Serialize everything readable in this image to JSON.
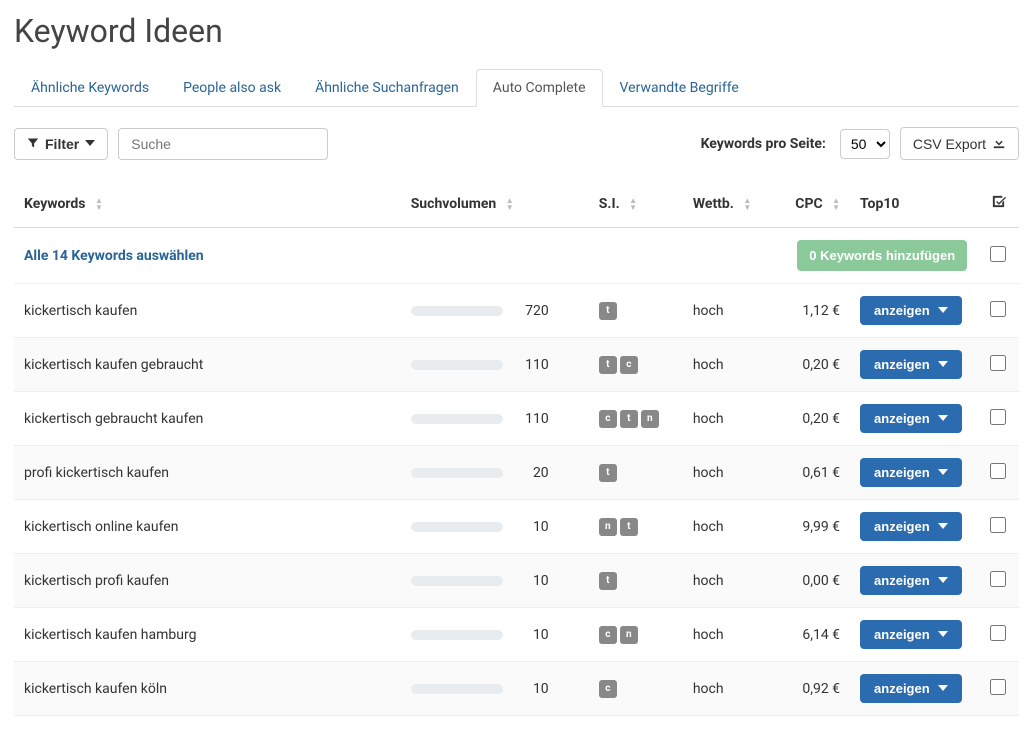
{
  "page_title": "Keyword Ideen",
  "tabs": [
    {
      "label": "Ähnliche Keywords",
      "active": false
    },
    {
      "label": "People also ask",
      "active": false
    },
    {
      "label": "Ähnliche Suchanfragen",
      "active": false
    },
    {
      "label": "Auto Complete",
      "active": true
    },
    {
      "label": "Verwandte Begriffe",
      "active": false
    }
  ],
  "controls": {
    "filter_label": "Filter",
    "search_placeholder": "Suche",
    "kps_label": "Keywords pro Seite:",
    "kps_value": "50",
    "export_label": "CSV Export"
  },
  "columns": {
    "keywords": "Keywords",
    "volume": "Suchvolumen",
    "si": "S.I.",
    "wettb": "Wettb.",
    "cpc": "CPC",
    "top10": "Top10"
  },
  "select_all": {
    "label": "Alle 14 Keywords auswählen",
    "add_button": "0 Keywords hinzufügen"
  },
  "show_label": "anzeigen",
  "volume_max": 720,
  "rows": [
    {
      "keyword": "kickertisch kaufen",
      "volume": 720,
      "si": [
        "t"
      ],
      "wettb": "hoch",
      "cpc": "1,12 €"
    },
    {
      "keyword": "kickertisch kaufen gebraucht",
      "volume": 110,
      "si": [
        "t",
        "c"
      ],
      "wettb": "hoch",
      "cpc": "0,20 €"
    },
    {
      "keyword": "kickertisch gebraucht kaufen",
      "volume": 110,
      "si": [
        "c",
        "t",
        "n"
      ],
      "wettb": "hoch",
      "cpc": "0,20 €"
    },
    {
      "keyword": "profi kickertisch kaufen",
      "volume": 20,
      "si": [
        "t"
      ],
      "wettb": "hoch",
      "cpc": "0,61 €"
    },
    {
      "keyword": "kickertisch online kaufen",
      "volume": 10,
      "si": [
        "n",
        "t"
      ],
      "wettb": "hoch",
      "cpc": "9,99 €"
    },
    {
      "keyword": "kickertisch profi kaufen",
      "volume": 10,
      "si": [
        "t"
      ],
      "wettb": "hoch",
      "cpc": "0,00 €"
    },
    {
      "keyword": "kickertisch kaufen hamburg",
      "volume": 10,
      "si": [
        "c",
        "n"
      ],
      "wettb": "hoch",
      "cpc": "6,14 €"
    },
    {
      "keyword": "kickertisch kaufen köln",
      "volume": 10,
      "si": [
        "c"
      ],
      "wettb": "hoch",
      "cpc": "0,92 €"
    }
  ]
}
